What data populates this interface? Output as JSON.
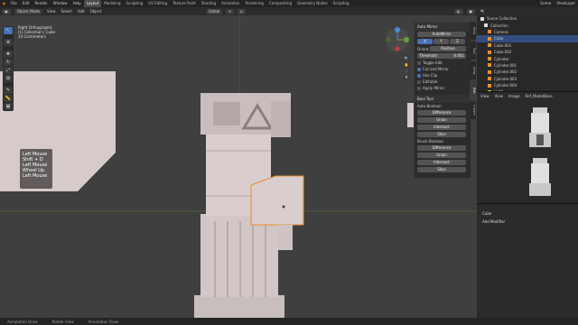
{
  "topbar": {
    "menus": [
      "File",
      "Edit",
      "Render",
      "Window",
      "Help"
    ],
    "workspaces": [
      "Layout",
      "Modeling",
      "Sculpting",
      "UV Editing",
      "Texture Paint",
      "Shading",
      "Animation",
      "Rendering",
      "Compositing",
      "Geometry Nodes",
      "Scripting"
    ],
    "scene": "Scene",
    "view_layer": "ViewLayer"
  },
  "header": {
    "mode": "Object Mode",
    "menus": [
      "View",
      "Select",
      "Add",
      "Object"
    ],
    "transform": "Global",
    "options": "Options"
  },
  "viewport_overlay": {
    "view": "Right Orthographic",
    "collection": "(1) Collection | Cube",
    "scale": "10 Centimeters"
  },
  "keys": [
    "Left Mouse",
    "Shift + D",
    "Left Mouse",
    "Wheel Up",
    "Left Mouse"
  ],
  "npanel": {
    "auto_mirror": {
      "title": "Auto Mirror",
      "button": "AutoMirror",
      "axes": [
        "X",
        "Y",
        "Z"
      ],
      "orientation_label": "Orient.",
      "orientation_value": "Positive",
      "threshold_label": "Threshold",
      "threshold_value": "0.001",
      "toggle_edit": "Toggle Edit",
      "cut_and_mirror": "Cut and Mirror",
      "use_clip": "Use Clip",
      "editable": "Editable",
      "apply_mirror": "Apply Mirror"
    },
    "bool_tool": {
      "title": "Bool Tool",
      "auto_boolean": "Auto Boolean",
      "brush_boolean": "Brush Boolean",
      "ops": [
        "Difference",
        "Union",
        "Intersect",
        "Slice"
      ]
    },
    "tabs": [
      "Item",
      "Tool",
      "View",
      "Edit",
      "Create"
    ]
  },
  "outliner": {
    "title": "Scene Collection",
    "items": [
      {
        "name": "Collection",
        "selected": false
      },
      {
        "name": "Camera",
        "selected": false
      },
      {
        "name": "Cube",
        "selected": true
      },
      {
        "name": "Cube.001",
        "selected": false
      },
      {
        "name": "Cube.002",
        "selected": false
      },
      {
        "name": "Cylinder",
        "selected": false
      },
      {
        "name": "Cylinder.001",
        "selected": false
      },
      {
        "name": "Cylinder.002",
        "selected": false
      },
      {
        "name": "Cylinder.003",
        "selected": false
      },
      {
        "name": "Cylinder.004",
        "selected": false
      },
      {
        "name": "Light",
        "selected": false
      }
    ]
  },
  "preview_header": {
    "menus": [
      "View",
      "View",
      "Image"
    ],
    "image": "Ref_ModelBase"
  },
  "properties": {
    "object": "Cube",
    "add_modifier": "Add Modifier"
  },
  "status": [
    "Annotation Draw",
    "Rotate View",
    "Annotation Draw"
  ],
  "colors": {
    "accent": "#4772b3",
    "selection_orange": "#e8902c",
    "object": "#d3c6c6"
  }
}
